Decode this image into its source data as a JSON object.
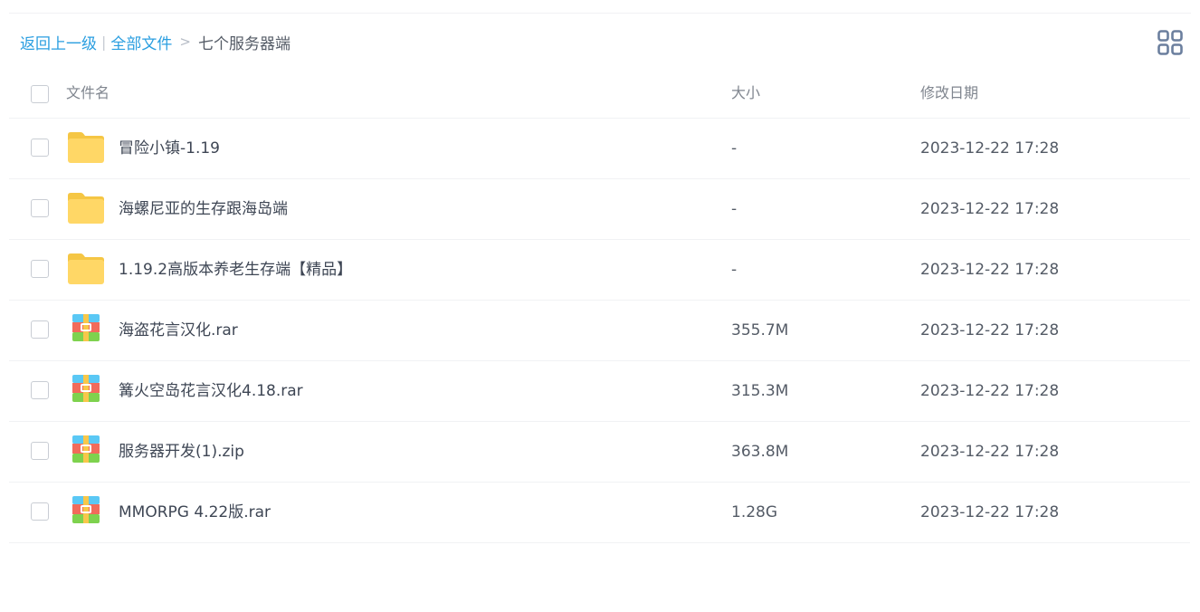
{
  "breadcrumb": {
    "back": "返回上一级",
    "separator": "|",
    "all_files": "全部文件",
    "arrow": ">",
    "current": "七个服务器端"
  },
  "table": {
    "headers": {
      "name": "文件名",
      "size": "大小",
      "modified": "修改日期"
    },
    "rows": [
      {
        "icon": "folder-icon",
        "name": "冒险小镇-1.19",
        "size": "-",
        "modified": "2023-12-22 17:28"
      },
      {
        "icon": "folder-icon",
        "name": "海螺尼亚的生存跟海岛端",
        "size": "-",
        "modified": "2023-12-22 17:28"
      },
      {
        "icon": "folder-icon",
        "name": "1.19.2高版本养老生存端【精品】",
        "size": "-",
        "modified": "2023-12-22 17:28"
      },
      {
        "icon": "archive-icon",
        "name": "海盗花言汉化.rar",
        "size": "355.7M",
        "modified": "2023-12-22 17:28"
      },
      {
        "icon": "archive-icon",
        "name": "篝火空岛花言汉化4.18.rar",
        "size": "315.3M",
        "modified": "2023-12-22 17:28"
      },
      {
        "icon": "archive-icon",
        "name": "服务器开发(1).zip",
        "size": "363.8M",
        "modified": "2023-12-22 17:28"
      },
      {
        "icon": "archive-icon",
        "name": "MMORPG 4.22版.rar",
        "size": "1.28G",
        "modified": "2023-12-22 17:28"
      }
    ]
  },
  "colors": {
    "link": "#2a9ee0",
    "folder": "#ffd766",
    "view_toggle": "#6b7f9e"
  }
}
